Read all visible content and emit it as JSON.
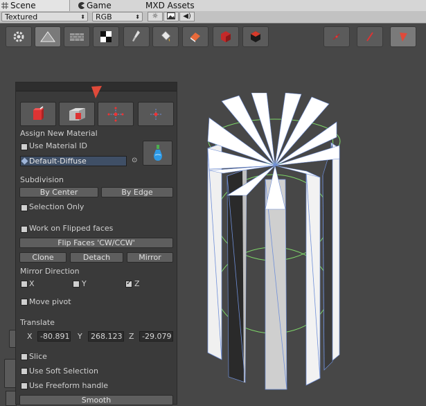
{
  "tabs": [
    {
      "label": "Scene",
      "icon": "scene-grid-icon"
    },
    {
      "label": "Game",
      "icon": "game-pacman-icon"
    },
    {
      "label": "MXD Assets"
    }
  ],
  "scene_toolbar": {
    "render_mode": "Textured",
    "color_mode": "RGB",
    "toggles": [
      "sun-icon",
      "image-icon",
      "audio-icon"
    ]
  },
  "viewport_toolbar": {
    "left_tools": [
      "gear-icon",
      "triangle-icon",
      "brick-wall-icon",
      "checker-icon",
      "brush-icon",
      "paint-bucket-icon",
      "eraser-icon",
      "red-box-icon",
      "dark-box-icon"
    ],
    "right_tools": [
      "vertex-mode-icon",
      "edge-mode-icon",
      "face-mode-icon"
    ]
  },
  "panel": {
    "assign_material_label": "Assign New Material",
    "use_material_id_label": "Use Material ID",
    "material_value": "Default-Diffuse",
    "subdivision_label": "Subdivision",
    "by_center_label": "By Center",
    "by_edge_label": "By Edge",
    "selection_only_label": "Selection Only",
    "flipped_faces_label": "Work on Flipped faces",
    "flip_faces_label": "Flip Faces 'CW/CCW'",
    "clone_label": "Clone",
    "detach_label": "Detach",
    "mirror_label": "Mirror",
    "mirror_direction_label": "Mirror Direction",
    "mirror_x_label": "X",
    "mirror_y_label": "Y",
    "mirror_z_label": "Z",
    "move_pivot_label": "Move pivot",
    "translate_label": "Translate",
    "translate_x_label": "X",
    "translate_x_value": "-80.891",
    "translate_y_label": "Y",
    "translate_y_value": "268.123",
    "translate_z_label": "Z",
    "translate_z_value": "-29.079",
    "slice_label": "Slice",
    "soft_selection_label": "Use Soft Selection",
    "freeform_label": "Use Freeform handle",
    "smooth_label": "Smooth"
  },
  "colors": {
    "viewport_bg": "#474747",
    "panel_bg": "#3a3a3a",
    "accent_red": "#d9443a",
    "wire_green": "#7fd96a",
    "wire_blue": "#6f8fd8"
  }
}
